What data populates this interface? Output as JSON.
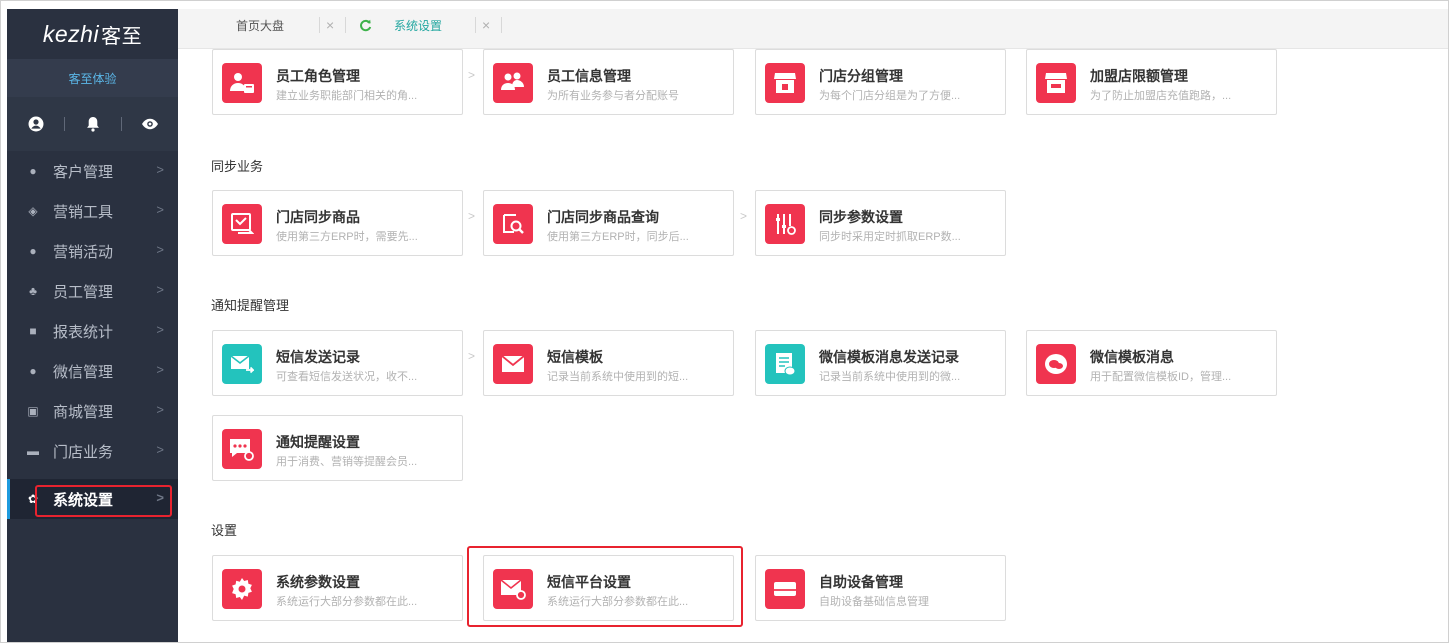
{
  "brand": {
    "logo_latin": "kezhi",
    "logo_cn": "客至",
    "experience": "客至体验"
  },
  "sidebar": {
    "icons": [
      "user-circle-icon",
      "bell-icon",
      "eye-icon"
    ],
    "items": [
      {
        "label": "客户管理",
        "arrow": ">",
        "icon": "person-icon"
      },
      {
        "label": "营销工具",
        "arrow": ">",
        "icon": "layers-icon"
      },
      {
        "label": "营销活动",
        "arrow": ">",
        "icon": "bulb-icon"
      },
      {
        "label": "员工管理",
        "arrow": ">",
        "icon": "staff-icon"
      },
      {
        "label": "报表统计",
        "arrow": ">",
        "icon": "report-icon"
      },
      {
        "label": "微信管理",
        "arrow": ">",
        "icon": "wechat-icon"
      },
      {
        "label": "商城管理",
        "arrow": ">",
        "icon": "shop-icon"
      },
      {
        "label": "门店业务",
        "arrow": ">",
        "icon": "store-icon"
      },
      {
        "label": "系统设置",
        "arrow": ">",
        "icon": "gear-icon",
        "active": true
      }
    ]
  },
  "tabs": [
    {
      "label": "首页大盘",
      "close": "×"
    },
    {
      "label": "系统设置",
      "close": "×",
      "active": true
    }
  ],
  "sections": {
    "sync": "同步业务",
    "notice": "通知提醒管理",
    "settings": "设置"
  },
  "cards": {
    "role": {
      "title": "员工角色管理",
      "desc": "建立业务职能部门相关的角..."
    },
    "staffinfo": {
      "title": "员工信息管理",
      "desc": "为所有业务参与者分配账号"
    },
    "storegroup": {
      "title": "门店分组管理",
      "desc": "为每个门店分组是为了方便..."
    },
    "franchise": {
      "title": "加盟店限额管理",
      "desc": "为了防止加盟店充值跑路，..."
    },
    "syncgoods": {
      "title": "门店同步商品",
      "desc": "使用第三方ERP时，需要先..."
    },
    "syncquery": {
      "title": "门店同步商品查询",
      "desc": "使用第三方ERP时，同步后..."
    },
    "syncparam": {
      "title": "同步参数设置",
      "desc": "同步时采用定时抓取ERP数..."
    },
    "smslog": {
      "title": "短信发送记录",
      "desc": "可查看短信发送状况，收不..."
    },
    "smstpl": {
      "title": "短信模板",
      "desc": "记录当前系统中使用到的短..."
    },
    "wxtpllog": {
      "title": "微信模板消息发送记录",
      "desc": "记录当前系统中使用到的微..."
    },
    "wxtpl": {
      "title": "微信模板消息",
      "desc": "用于配置微信模板ID，管理..."
    },
    "notify": {
      "title": "通知提醒设置",
      "desc": "用于消费、营销等提醒会员..."
    },
    "sysparam": {
      "title": "系统参数设置",
      "desc": "系统运行大部分参数都在此..."
    },
    "smsplat": {
      "title": "短信平台设置",
      "desc": "系统运行大部分参数都在此..."
    },
    "device": {
      "title": "自助设备管理",
      "desc": "自助设备基础信息管理"
    }
  },
  "colors": {
    "accent_red": "#f0344f",
    "accent_teal": "#23c3bd",
    "sidebar_bg": "#2a3140",
    "highlight": "#e8232f"
  }
}
